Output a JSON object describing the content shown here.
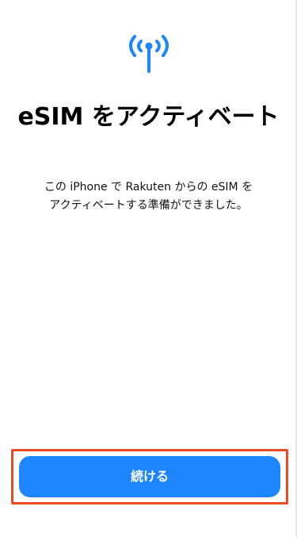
{
  "screen": {
    "title_line1": "eSIM をアクティベート",
    "title_line2": "",
    "description_line1": "この iPhone で Rakuten からの eSIM を",
    "description_line2": "アクティベートする準備ができました。"
  },
  "actions": {
    "continue_label": "続ける"
  },
  "icons": {
    "signal": "antenna-signal-icon"
  },
  "colors": {
    "accent": "#1d86ff",
    "highlight": "#ec4a23"
  }
}
